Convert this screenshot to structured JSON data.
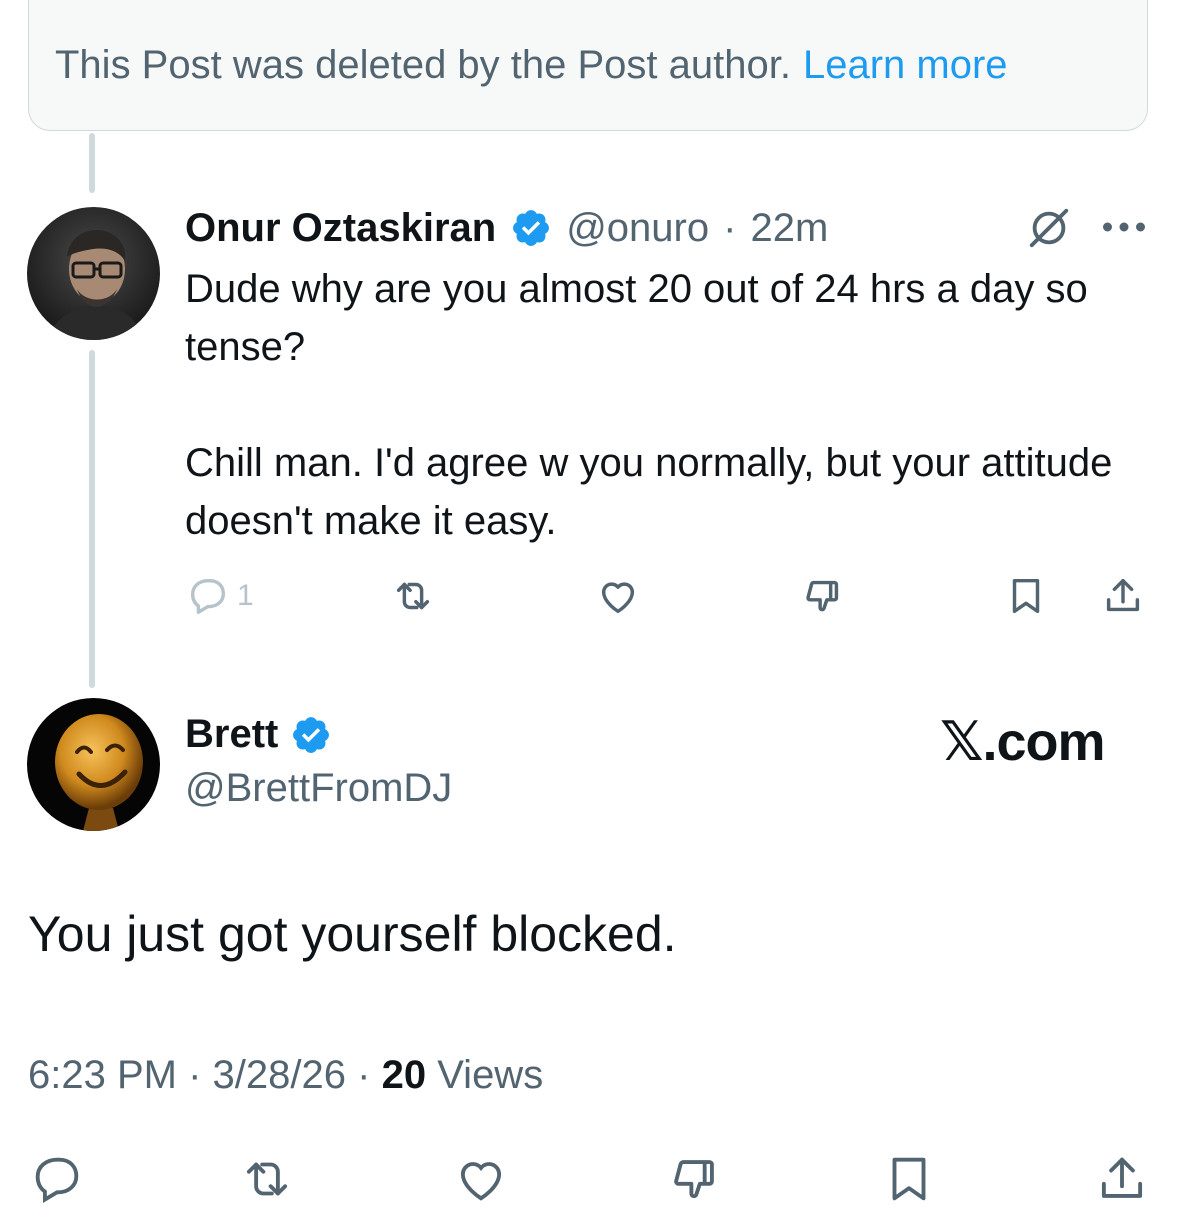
{
  "deleted_notice": {
    "text": "This Post was deleted by the Post author.",
    "link": "Learn more"
  },
  "reply": {
    "author_name": "Onur Oztaskiran",
    "handle": "@onuro",
    "separator": "·",
    "time": "22m",
    "text_p1": "Dude why are you almost 20 out of 24 hrs a day so tense?",
    "text_p2": "Chill man. I'd agree w you normally, but your attitude doesn't make it easy.",
    "reply_count": "1",
    "actions": [
      "reply-icon",
      "repost-icon",
      "like-icon",
      "downvote-icon",
      "bookmark-icon",
      "share-icon"
    ]
  },
  "main_post": {
    "author_name": "Brett",
    "handle": "@BrettFromDJ",
    "watermark": "𝕏.com",
    "text": "You just got yourself blocked.",
    "time": "6:23 PM",
    "date": "3/28/26",
    "separator": "·",
    "views_count": "20",
    "views_label": "Views"
  },
  "colors": {
    "accent": "#1d9bf0",
    "muted": "#536471",
    "text": "#0f1419",
    "border": "#cfd9de"
  }
}
